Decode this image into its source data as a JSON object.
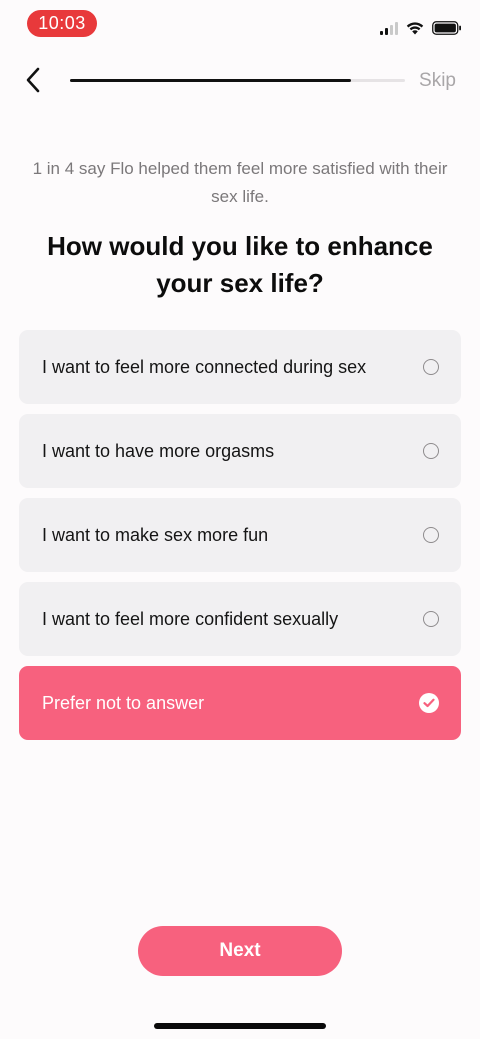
{
  "status_bar": {
    "time": "10:03",
    "signal_icon": "cellular-signal-icon",
    "wifi_icon": "wifi-icon",
    "battery_icon": "battery-icon"
  },
  "nav": {
    "back_icon": "chevron-left-icon",
    "progress": 0.84,
    "skip_label": "Skip"
  },
  "subtitle": "1 in 4 say Flo helped them feel more satisfied with their sex life.",
  "question": "How would you like to enhance your sex life?",
  "options": [
    {
      "label": "I want to feel more connected during sex",
      "selected": false
    },
    {
      "label": "I want to have more orgasms",
      "selected": false
    },
    {
      "label": "I want to make sex more fun",
      "selected": false
    },
    {
      "label": "I want to feel more confident sexually",
      "selected": false
    },
    {
      "label": "Prefer not to answer",
      "selected": true
    }
  ],
  "next_label": "Next",
  "colors": {
    "accent": "#f7617e",
    "time_pill": "#e8393b",
    "option_bg": "#f1f0f2"
  }
}
